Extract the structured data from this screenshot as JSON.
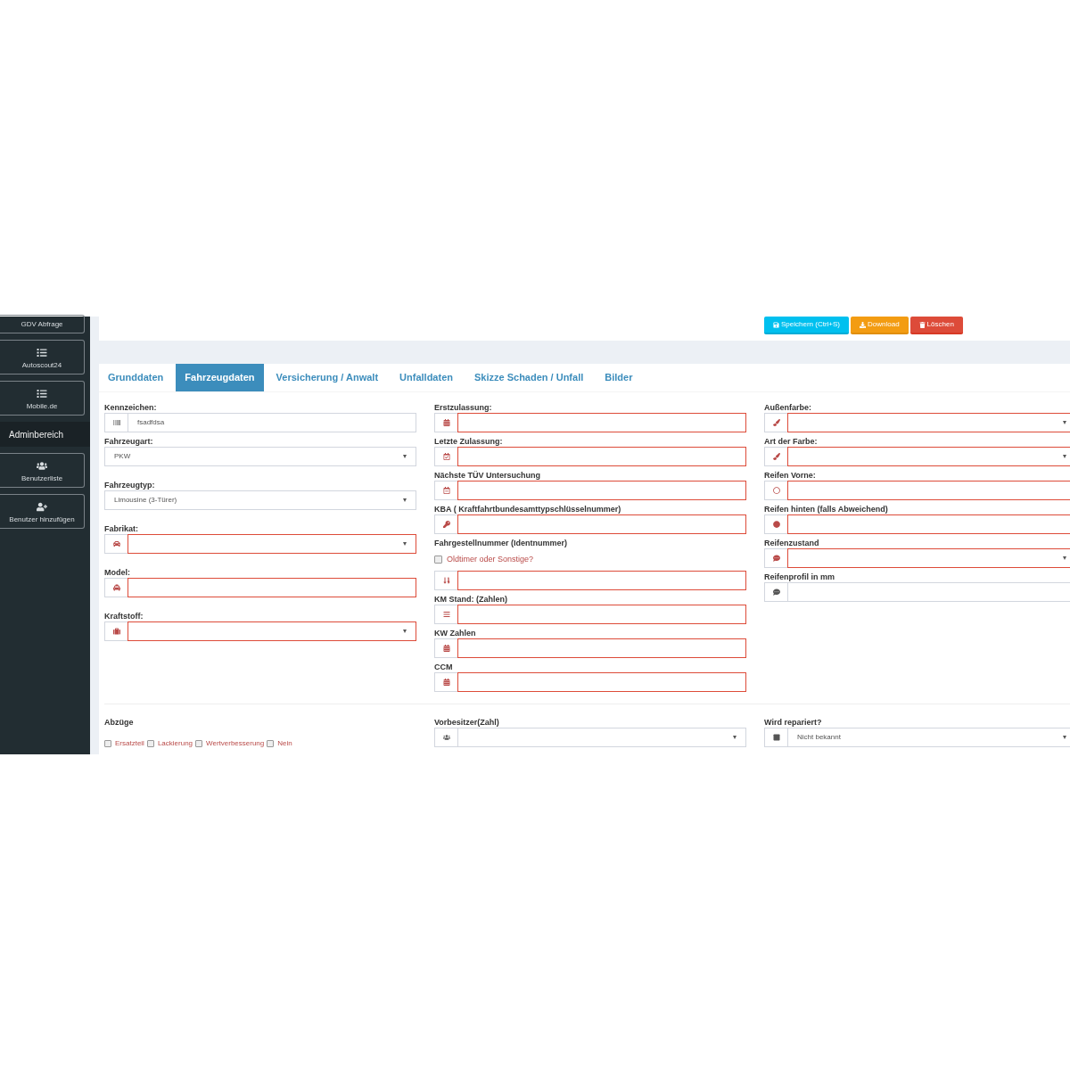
{
  "sidebar": {
    "items": [
      {
        "kind": "button",
        "label": "GDV Abfrage"
      },
      {
        "kind": "button",
        "label": "Autoscout24"
      },
      {
        "kind": "button",
        "label": "Mobile.de"
      },
      {
        "kind": "header",
        "label": "Adminbereich"
      },
      {
        "kind": "button",
        "label": "Benutzerliste"
      },
      {
        "kind": "button",
        "label": "Benutzer hinzufügen"
      }
    ]
  },
  "toolbar": {
    "buttons": [
      {
        "kind": "save",
        "label": "Speichern (Ctrl+S)"
      },
      {
        "kind": "download",
        "label": "Download"
      },
      {
        "kind": "delete",
        "label": "Löschen"
      }
    ]
  },
  "tabs": [
    {
      "label": "Grunddaten",
      "selected": false
    },
    {
      "label": "Fahrzeugdaten",
      "selected": true
    },
    {
      "label": "Versicherung / Anwalt",
      "selected": false
    },
    {
      "label": "Unfalldaten",
      "selected": false
    },
    {
      "label": "Skizze Schaden / Unfall",
      "selected": false
    },
    {
      "label": "Bilder",
      "selected": false
    }
  ],
  "columns": [
    [
      {
        "label": "Kennzeichen:",
        "kind": "input",
        "value": "fsadfdsa",
        "invalid": false
      },
      {
        "label": "Fahrzeugart:",
        "kind": "select",
        "value": "PKW",
        "invalid": false
      },
      {
        "label": "Fahrzeugtyp:",
        "kind": "select",
        "value": "Limousine (3-Türer)",
        "invalid": false
      },
      {
        "label": "Fabrikat:",
        "kind": "select",
        "invalid": true
      },
      {
        "label": "Model:",
        "kind": "input",
        "invalid": true
      },
      {
        "label": "Kraftstoff:",
        "kind": "select",
        "invalid": true
      }
    ],
    [
      {
        "label": "Erstzulassung:",
        "kind": "input",
        "invalid": true
      },
      {
        "label": "Letzte Zulassung:",
        "kind": "input",
        "invalid": true
      },
      {
        "label": "Nächste TÜV Untersuchung",
        "kind": "input",
        "invalid": true
      },
      {
        "label": "KBA ( Kraftfahrtbundesamttypschlüsselnummer)",
        "kind": "input",
        "invalid": true
      },
      {
        "label": "Fahrgestellnummer (Identnummer)",
        "kind": "input",
        "invalid": true,
        "option": {
          "label": "Oldtimer oder Sonstige?",
          "checked": false
        }
      },
      {
        "label": "KM Stand: (Zahlen)",
        "kind": "input",
        "invalid": true
      },
      {
        "label": "KW Zahlen",
        "kind": "input",
        "invalid": true
      },
      {
        "label": "CCM",
        "kind": "input",
        "invalid": true
      }
    ],
    [
      {
        "label": "Außenfarbe:",
        "kind": "select",
        "invalid": true
      },
      {
        "label": "Art der Farbe:",
        "kind": "select",
        "invalid": true
      },
      {
        "label": "Reifen Vorne:",
        "kind": "input",
        "invalid": true
      },
      {
        "label": "Reifen hinten (falls Abweichend)",
        "kind": "input",
        "invalid": true
      },
      {
        "label": "Reifenzustand",
        "kind": "select",
        "invalid": true
      },
      {
        "label": "Reifenprofil in mm",
        "kind": "input",
        "invalid": false
      }
    ]
  ],
  "bottom": [
    {
      "label": "Abzüge",
      "kind": "checkboxes",
      "options": [
        {
          "label": "Ersatzteil",
          "checked": false
        },
        {
          "label": "Lackierung",
          "checked": false
        },
        {
          "label": "Wertverbesserung",
          "checked": false
        },
        {
          "label": "Nein",
          "checked": false
        }
      ]
    },
    {
      "label": "Vorbesitzer(Zahl)",
      "kind": "select",
      "invalid": false
    },
    {
      "label": "Wird repariert?",
      "kind": "select",
      "value": "Nicht bekannt",
      "invalid": false
    }
  ]
}
